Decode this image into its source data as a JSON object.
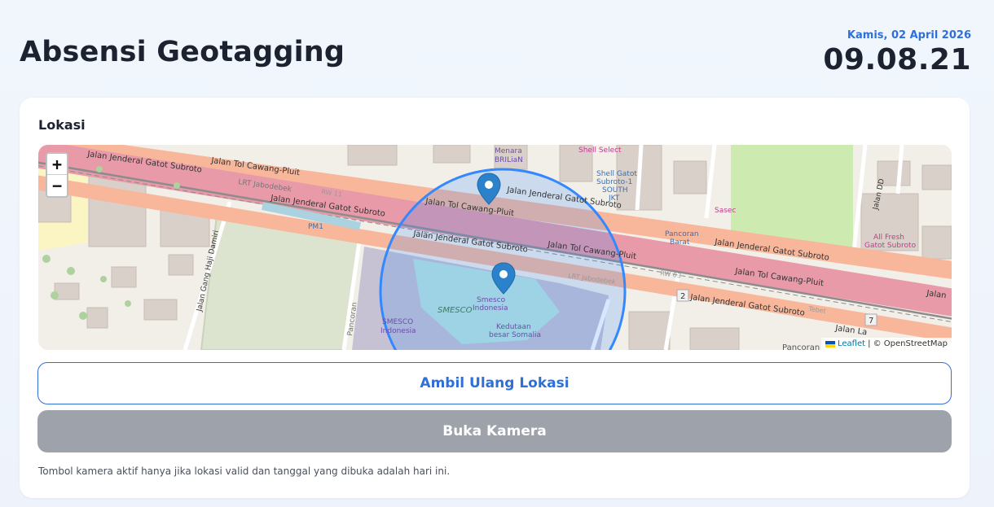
{
  "page": {
    "title": "Absensi Geotagging"
  },
  "datetime": {
    "date": "Kamis, 02 April 2026",
    "time": "09.08.21"
  },
  "card": {
    "section_label": "Lokasi",
    "retake_button": "Ambil Ulang Lokasi",
    "camera_button": "Buka Kamera",
    "hint": "Tombol kamera aktif hanya jika lokasi valid dan tanggal yang dibuka adalah hari ini."
  },
  "map": {
    "zoom_in": "+",
    "zoom_out": "−",
    "attribution_leaflet": "Leaflet",
    "attribution_rest": "| © OpenStreetMap",
    "labels": {
      "road_top_left": "Jalan Tol Cawang-Pluit",
      "road_top_left2": "Jalan Jenderal Gatot Subroto",
      "lrt": "LRT Jabodebek",
      "road_mid_left": "Jalan Jenderal Gatot Subroto",
      "road_mid_right": "Jalan Jenderal Gatot Subroto",
      "toll_mid": "Jalan Tol Cawang-Pluit",
      "road_upper": "Jalan Jenderal Gatot Subroto",
      "toll_right": "Jalan Tol Cawang-Pluit",
      "road_right": "Jalan Jenderal Gatot Subroto",
      "road_right2": "Jalan Jenderal Gatot Subroto",
      "road_far_right": "Jalan",
      "road_far_right2": "Jalan La",
      "toll_upper": "Jalan Tol Cawang-Pluit",
      "jalan_dd": "Jalan DD",
      "jalan_gang": "Jalan Gang Haji Damiri",
      "pancoran": "Pancoran",
      "pancoran_bottom": "Pancoran",
      "menara_1": "Menara",
      "menara_2": "BRILiaN",
      "shell_select": "Shell Select",
      "shell_1": "Shell Gatot",
      "shell_2": "Subroto-1",
      "shell_3": "SOUTH",
      "shell_4": "JKT",
      "sasec": "Sasec",
      "pancoran_barat_1": "Pancoran",
      "pancoran_barat_2": "Barat",
      "allfresh_1": "All Fresh",
      "allfresh_2": "Gatot Subroto",
      "pm1": "PM1",
      "smesco_big": "SMESCO",
      "smesco_1": "Smesco",
      "smesco_2": "Indonesia",
      "smesco_left_1": "SMESCO",
      "smesco_left_2": "Indonesia",
      "kedutaan_1": "Kedutaan",
      "kedutaan_2": "besar Somalia",
      "rw1": "RW 11",
      "rw2": "RW 03",
      "lrt_right": "LRT Jabodebek",
      "route_2": "2",
      "route_7": "7",
      "tebet": "Tebet"
    }
  },
  "colors": {
    "accent": "#2f6fd8",
    "toll_road": "#e89aa8",
    "primary_road": "#f8b79a",
    "radius_circle": "#3388ff",
    "marker": "#2b82cb",
    "disabled_button": "#9ea3ab"
  },
  "icons": [
    "marker-icon",
    "zoom-in-icon",
    "zoom-out-icon",
    "ukraine-flag-icon"
  ]
}
